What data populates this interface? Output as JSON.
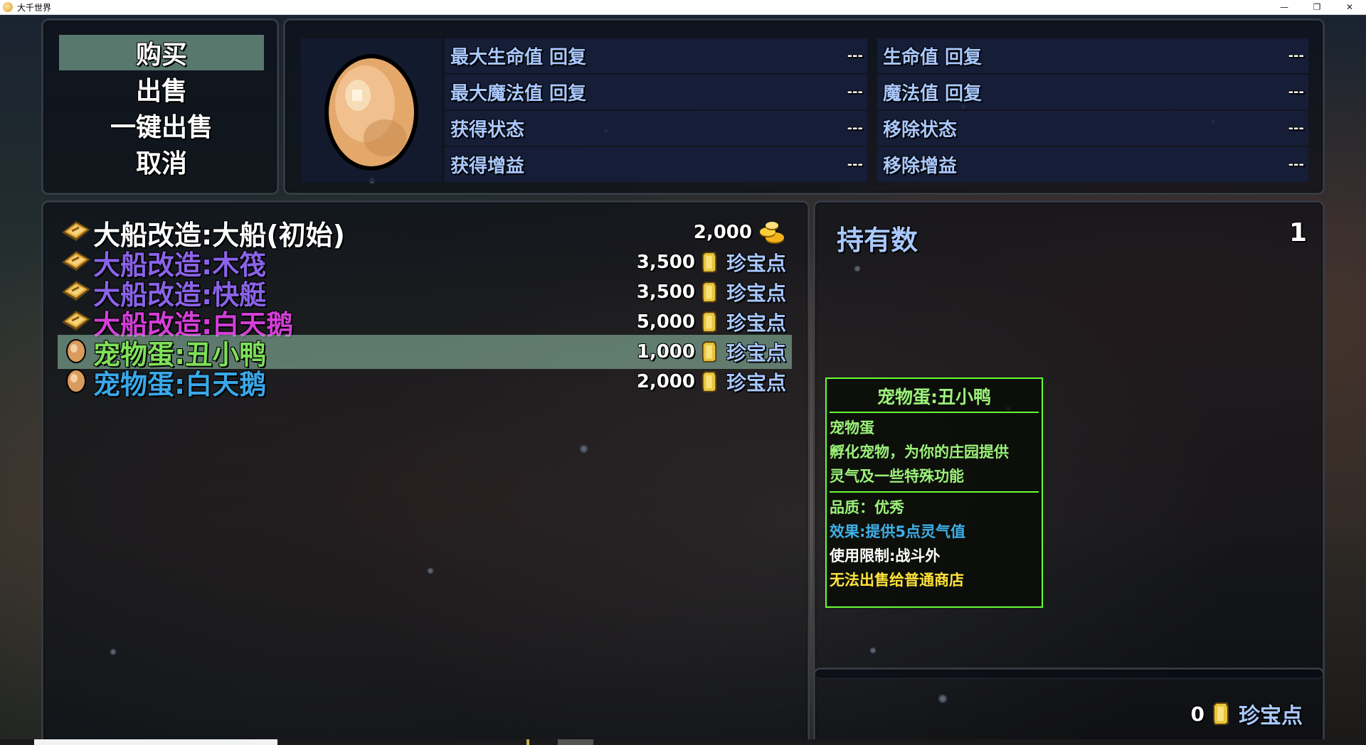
{
  "window": {
    "title": "大千世界",
    "controls": [
      "—",
      "❐",
      "✕"
    ]
  },
  "commands": [
    {
      "label": "购买",
      "selected": true
    },
    {
      "label": "出售",
      "selected": false
    },
    {
      "label": "一键出售",
      "selected": false
    },
    {
      "label": "取消",
      "selected": false
    }
  ],
  "status": {
    "preview_icon": "egg-icon",
    "cells": [
      {
        "label": "最大生命值 回复",
        "value": "---"
      },
      {
        "label": "生命值 回复",
        "value": "---"
      },
      {
        "label": "最大魔法值 回复",
        "value": "---"
      },
      {
        "label": "魔法值 回复",
        "value": "---"
      },
      {
        "label": "获得状态",
        "value": "---"
      },
      {
        "label": "移除状态",
        "value": "---"
      },
      {
        "label": "获得增益",
        "value": "---"
      },
      {
        "label": "移除增益",
        "value": "---"
      }
    ]
  },
  "items": [
    {
      "icon": "ship-plank-icon",
      "name": "大船改造:大船(初始)",
      "name_color": "#ffffff",
      "price": "2,000",
      "currency_icon": "gold-coins-icon",
      "currency": "",
      "selected": false
    },
    {
      "icon": "ship-plank-icon",
      "name": "大船改造:木筏",
      "name_color": "#8a63e8",
      "price": "3,500",
      "currency_icon": "gem-card-icon",
      "currency": "珍宝点",
      "selected": false
    },
    {
      "icon": "ship-plank-icon",
      "name": "大船改造:快艇",
      "name_color": "#8a63e8",
      "price": "3,500",
      "currency_icon": "gem-card-icon",
      "currency": "珍宝点",
      "selected": false
    },
    {
      "icon": "ship-plank-icon",
      "name": "大船改造:白天鹅",
      "name_color": "#d23fd6",
      "price": "5,000",
      "currency_icon": "gem-card-icon",
      "currency": "珍宝点",
      "selected": false
    },
    {
      "icon": "egg-icon",
      "name": "宠物蛋:丑小鸭",
      "name_color": "#7fe05a",
      "price": "1,000",
      "currency_icon": "gem-card-icon",
      "currency": "珍宝点",
      "selected": true
    },
    {
      "icon": "egg-icon",
      "name": "宠物蛋:白天鹅",
      "name_color": "#3aa7e8",
      "price": "2,000",
      "currency_icon": "gem-card-icon",
      "currency": "珍宝点",
      "selected": false
    }
  ],
  "owned": {
    "label": "持有数",
    "count": "1"
  },
  "tooltip": {
    "title": "宠物蛋:丑小鸭",
    "type": "宠物蛋",
    "desc_line1": "孵化宠物，为你的庄园提供",
    "desc_line2": "灵气及一些特殊功能",
    "quality": "品质：优秀",
    "effect": "效果:提供5点灵气值",
    "restriction": "使用限制:战斗外",
    "sell_note": "无法出售给普通商店",
    "colors": {
      "title": "#9cf27a",
      "body": "#9cf27a",
      "effect": "#3fb0e8",
      "restriction": "#ffffff",
      "sell_note": "#ffe23a"
    }
  },
  "wallet": {
    "amount": "0",
    "currency_icon": "gem-card-icon",
    "currency": "珍宝点"
  }
}
